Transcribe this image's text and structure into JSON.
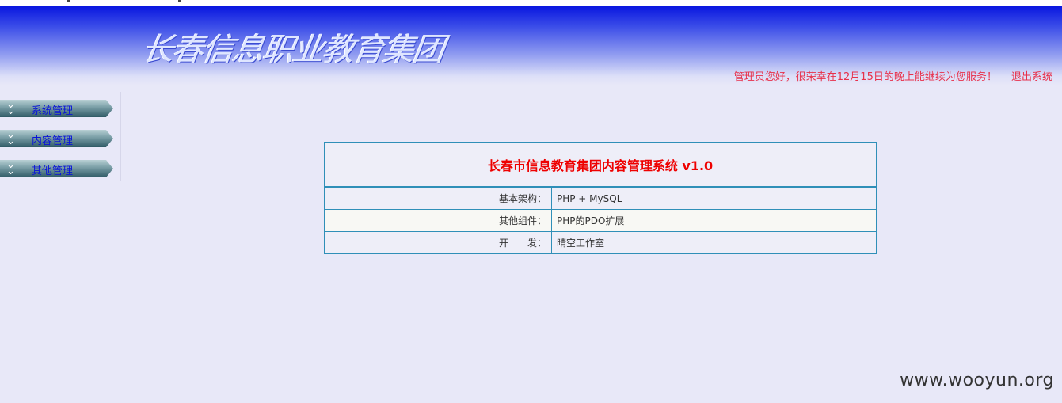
{
  "header": {
    "logo_text": "长春信息职业教育集团",
    "welcome": "管理员您好，很荣幸在12月15日的晚上能继续为您服务！",
    "logout": "退出系统"
  },
  "sidebar": {
    "items": [
      {
        "label": "系统管理"
      },
      {
        "label": "内容管理"
      },
      {
        "label": "其他管理"
      }
    ]
  },
  "info": {
    "title": "长春市信息教育集团内容管理系统 v1.0",
    "rows": [
      {
        "key": "基本架构：",
        "value": "PHP + MySQL"
      },
      {
        "key": "其他组件：",
        "value": "PHP的PDO扩展"
      },
      {
        "key": "开　　发：",
        "value": "晴空工作室"
      }
    ]
  },
  "watermark": "www.wooyun.org",
  "colors": {
    "header_top": "#0a17e0",
    "welcome_text": "#e8304a",
    "title_red": "#ee0000",
    "menu_label": "#0a14d8",
    "table_border": "#2f8fb8"
  }
}
